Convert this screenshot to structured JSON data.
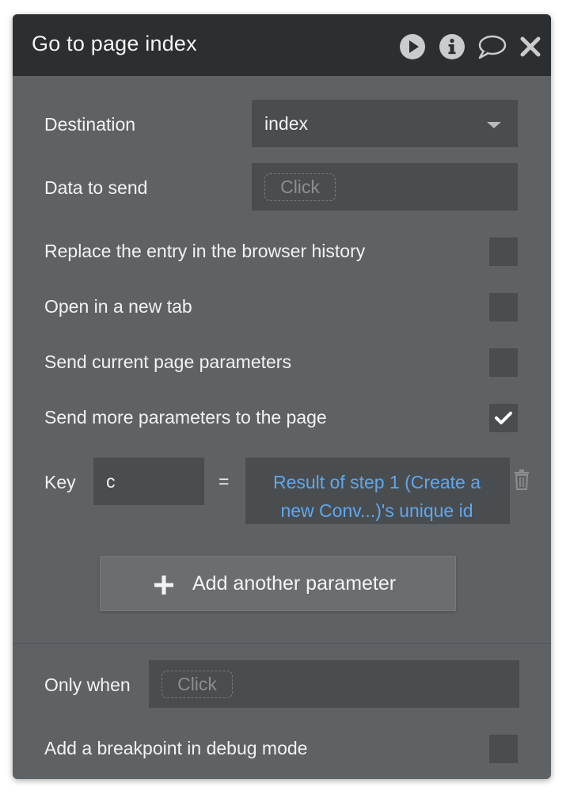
{
  "header": {
    "title": "Go to page index",
    "icons": [
      "play-icon",
      "info-icon",
      "comment-icon",
      "close-icon"
    ]
  },
  "destination": {
    "label": "Destination",
    "value": "index"
  },
  "data_to_send": {
    "label": "Data to send",
    "placeholder": "Click"
  },
  "options": [
    {
      "label": "Replace the entry in the browser history",
      "checked": false
    },
    {
      "label": "Open in a new tab",
      "checked": false
    },
    {
      "label": "Send current page parameters",
      "checked": false
    },
    {
      "label": "Send more parameters to the page",
      "checked": true
    }
  ],
  "parameter": {
    "key_label": "Key",
    "key_value": "c",
    "equals": "=",
    "value": "Result of step 1 (Create a new Conv...)'s unique id"
  },
  "add_parameter_button": {
    "label": "Add another parameter"
  },
  "only_when": {
    "label": "Only when",
    "placeholder": "Click"
  },
  "breakpoint": {
    "label": "Add a breakpoint in debug mode",
    "checked": false
  },
  "colors": {
    "header_bg": "#2b2f31",
    "panel_bg": "#5f6265",
    "field_bg": "#4a4d50",
    "dynamic_text": "#5ea7ee"
  }
}
